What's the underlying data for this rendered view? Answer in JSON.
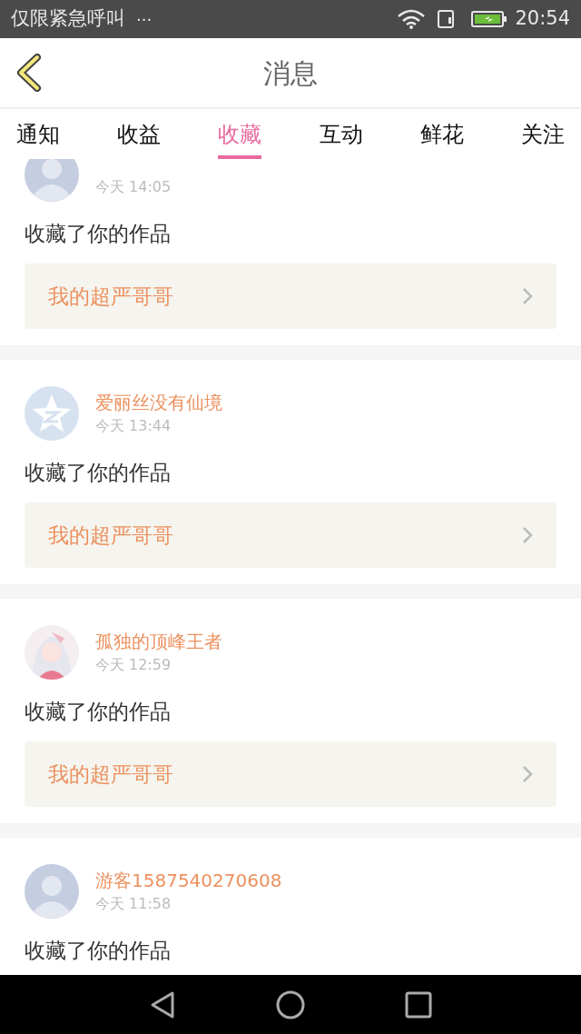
{
  "status_bar": {
    "carrier": "仅限紧急呼叫",
    "more": "···",
    "time": "20:54"
  },
  "header": {
    "title": "消息"
  },
  "tabs": [
    {
      "label": "通知",
      "selected": false
    },
    {
      "label": "收益",
      "selected": false
    },
    {
      "label": "收藏",
      "selected": true
    },
    {
      "label": "互动",
      "selected": false
    },
    {
      "label": "鲜花",
      "selected": false
    },
    {
      "label": "关注",
      "selected": false
    }
  ],
  "messages": [
    {
      "kind": "person",
      "time": "今天 14:05",
      "action": "收藏了你的作品",
      "work": "我的超严哥哥"
    },
    {
      "kind": "star",
      "name": "爱丽丝没有仙境",
      "time": "今天 13:44",
      "action": "收藏了你的作品",
      "work": "我的超严哥哥"
    },
    {
      "kind": "picture",
      "name": "孤独的顶峰王者",
      "time": "今天 12:59",
      "action": "收藏了你的作品",
      "work": "我的超严哥哥"
    },
    {
      "kind": "person",
      "name": "游客1587540270608",
      "time": "今天 11:58",
      "action": "收藏了你的作品"
    }
  ]
}
